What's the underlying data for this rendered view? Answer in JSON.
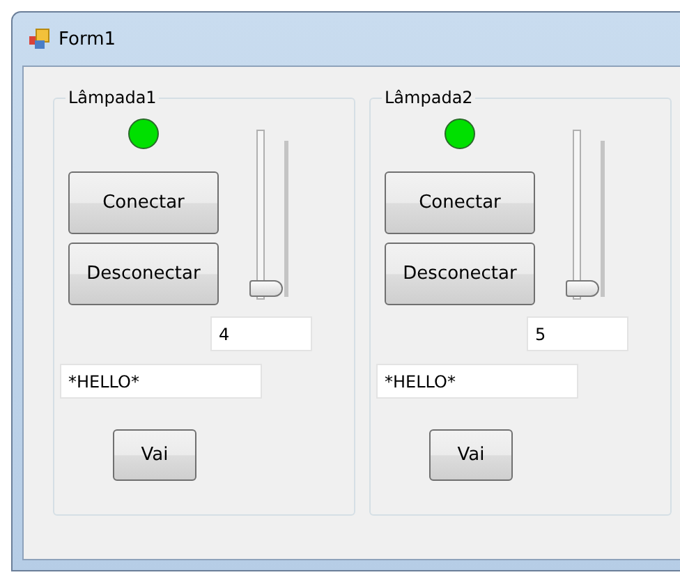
{
  "window": {
    "title": "Form1"
  },
  "groups": [
    {
      "title": "Lâmpada1",
      "lamp_on": true,
      "connect": "Conectar",
      "disconnect": "Desconectar",
      "slider": {
        "level": 0
      },
      "number": "4",
      "message": "*HELLO*",
      "go": "Vai"
    },
    {
      "title": "Lâmpada2",
      "lamp_on": true,
      "connect": "Conectar",
      "disconnect": "Desconectar",
      "slider": {
        "level": 0
      },
      "number": "5",
      "message": "*HELLO*",
      "go": "Vai"
    }
  ]
}
